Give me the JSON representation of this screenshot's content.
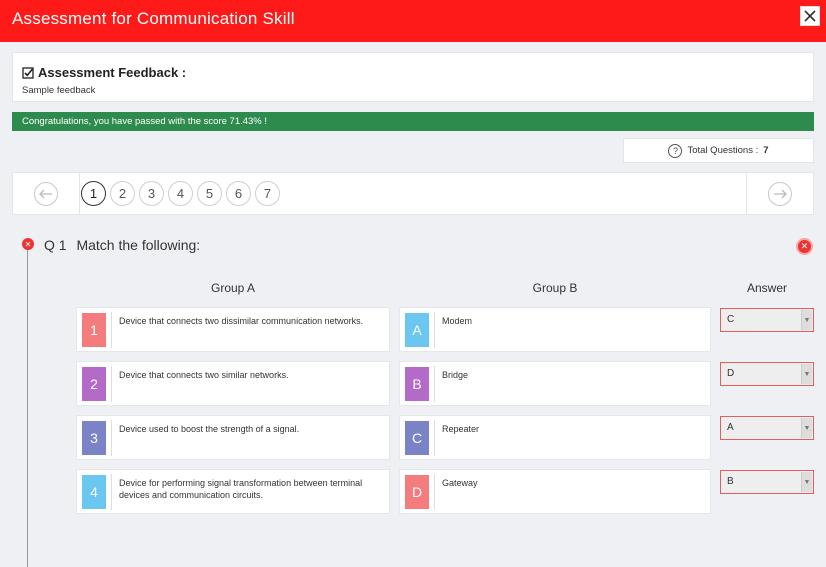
{
  "window": {
    "title": "Assessment for Communication Skill"
  },
  "feedback": {
    "heading": "Assessment Feedback :",
    "body": "Sample feedback"
  },
  "result": {
    "message": "Congratulations, you have passed with the score 71.43% !",
    "color": "#2e8b4e"
  },
  "summary": {
    "total_label": "Total Questions :",
    "total_value": "7"
  },
  "pager": {
    "pages": [
      "1",
      "2",
      "3",
      "4",
      "5",
      "6",
      "7"
    ],
    "current": "1"
  },
  "question": {
    "number": "Q 1",
    "text": "Match the following:",
    "status": "incorrect",
    "group_a_label": "Group A",
    "group_b_label": "Group B",
    "answer_label": "Answer",
    "group_a": [
      {
        "tag": "1",
        "text": "Device that connects two dissimilar communication networks.",
        "color": "#f47c7c"
      },
      {
        "tag": "2",
        "text": "Device that connects two similar networks.",
        "color": "#b46ac8"
      },
      {
        "tag": "3",
        "text": "Device used to boost the strength of a signal.",
        "color": "#7a83c6"
      },
      {
        "tag": "4",
        "text": "Device for performing signal transformation between terminal devices and communication circuits.",
        "color": "#6cc7f0"
      }
    ],
    "group_b": [
      {
        "tag": "A",
        "text": "Modem",
        "color": "#6cc7f0"
      },
      {
        "tag": "B",
        "text": "Bridge",
        "color": "#b46ac8"
      },
      {
        "tag": "C",
        "text": "Repeater",
        "color": "#7a83c6"
      },
      {
        "tag": "D",
        "text": "Gateway",
        "color": "#f47c7c"
      }
    ],
    "answers": [
      "C",
      "D",
      "A",
      "B"
    ]
  },
  "colors": {
    "header": "#ff1a1a",
    "error": "#e33333"
  }
}
